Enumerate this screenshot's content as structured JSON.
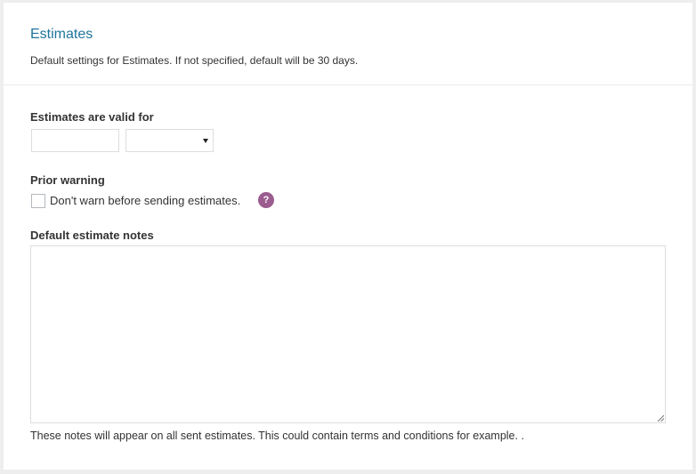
{
  "section": {
    "title": "Estimates",
    "description": "Default settings for Estimates. If not specified, default will be 30 days."
  },
  "valid_for": {
    "label": "Estimates are valid for",
    "number_value": "",
    "unit_value": ""
  },
  "prior_warning": {
    "label": "Prior warning",
    "checkbox_label": "Don't warn before sending estimates.",
    "checked": false,
    "help_glyph": "?"
  },
  "notes": {
    "label": "Default estimate notes",
    "value": "",
    "hint": "These notes will appear on all sent estimates. This could contain terms and conditions for example. ."
  },
  "icons": {
    "help": "help-icon",
    "dropdown": "chevron-down-icon",
    "resize": "resize-grip-icon"
  },
  "colors": {
    "title": "#21759b",
    "help_badge": "#9b5c8f",
    "page_background": "#eeeeee"
  }
}
